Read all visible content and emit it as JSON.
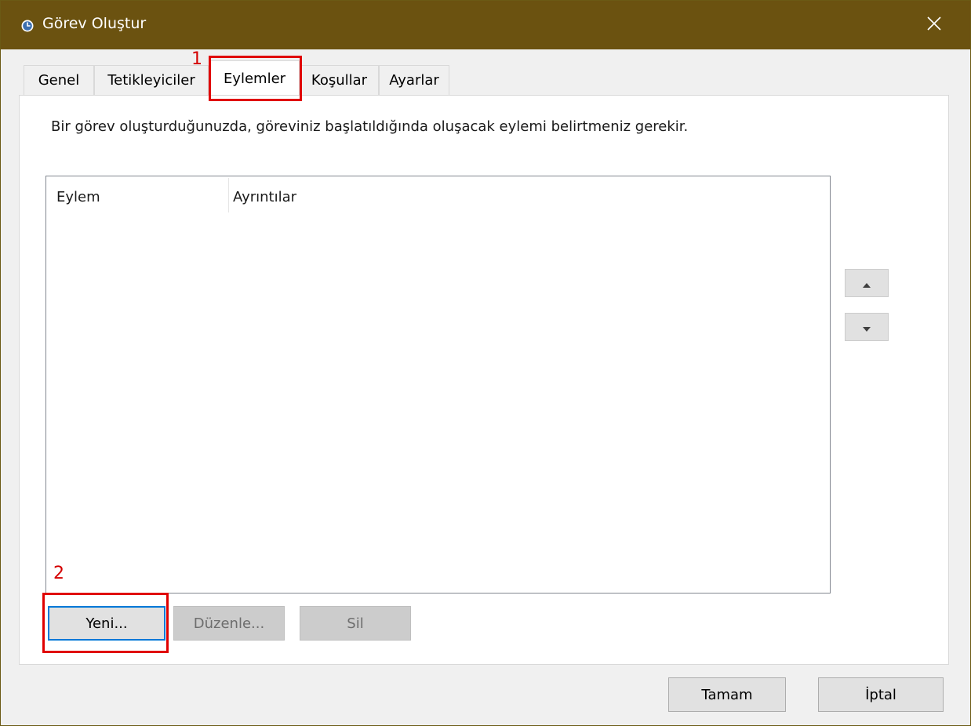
{
  "window": {
    "title": "Görev Oluştur",
    "close_glyph": "✕",
    "title_icon": "clock-icon",
    "titlebar_color": "#6b5210"
  },
  "tabs": [
    {
      "label": "Genel",
      "active": false
    },
    {
      "label": "Tetikleyiciler",
      "active": false
    },
    {
      "label": "Eylemler",
      "active": true
    },
    {
      "label": "Koşullar",
      "active": false
    },
    {
      "label": "Ayarlar",
      "active": false
    }
  ],
  "actions_tab": {
    "description": "Bir görev oluşturduğunuzda, göreviniz başlatıldığında oluşacak eylemi belirtmeniz gerekir.",
    "columns": [
      "Eylem",
      "Ayrıntılar"
    ],
    "rows": [],
    "move_up_icon": "arrow-up-icon",
    "move_down_icon": "arrow-down-icon",
    "buttons": {
      "new": "Yeni...",
      "edit": "Düzenle...",
      "delete": "Sil"
    }
  },
  "footer": {
    "ok": "Tamam",
    "cancel": "İptal"
  },
  "annotations": {
    "color": "#e00000",
    "step1": "1",
    "step2": "2"
  }
}
